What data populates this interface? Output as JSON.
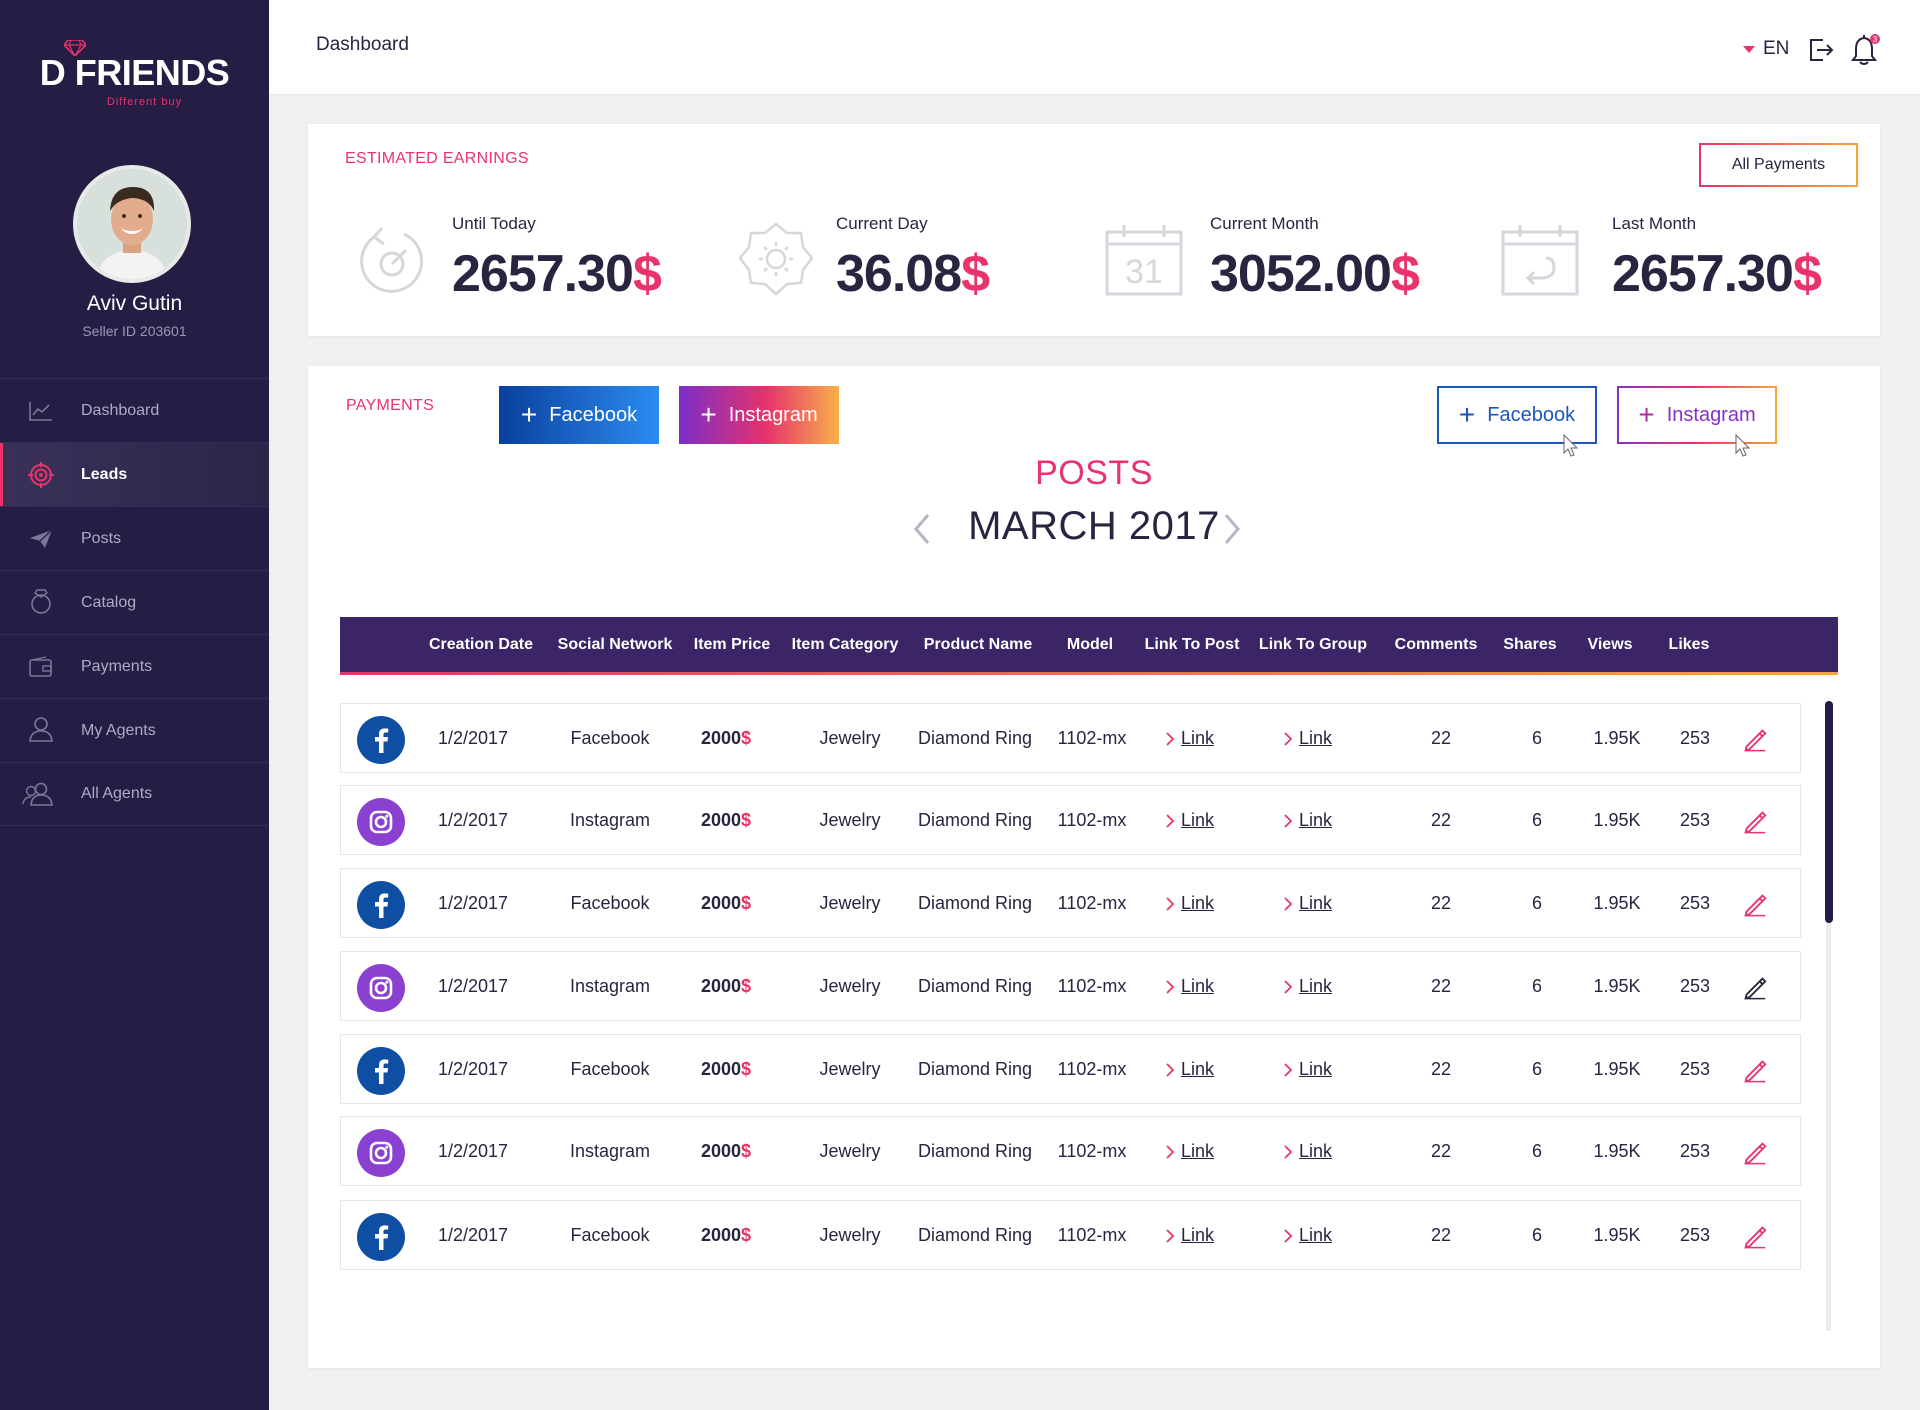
{
  "brand": {
    "name": "D FRIENDS",
    "tagline": "Different buy",
    "accent": "#e8336b",
    "sidebar_bg": "#251d44"
  },
  "user": {
    "name": "Aviv Gutin",
    "seller_id": "Seller ID 203601"
  },
  "sidebar": {
    "items": [
      {
        "label": "Dashboard",
        "icon": "chart-line-icon",
        "active": false
      },
      {
        "label": "Leads",
        "icon": "target-icon",
        "active": true
      },
      {
        "label": "Posts",
        "icon": "paper-plane-icon",
        "active": false
      },
      {
        "label": "Catalog",
        "icon": "ring-icon",
        "active": false
      },
      {
        "label": "Payments",
        "icon": "wallet-icon",
        "active": false
      },
      {
        "label": "My Agents",
        "icon": "user-icon",
        "active": false
      },
      {
        "label": "All Agents",
        "icon": "users-icon",
        "active": false
      }
    ]
  },
  "header": {
    "title": "Dashboard",
    "language": "EN",
    "notifications": "3"
  },
  "earnings": {
    "label": "ESTIMATED EARNINGS",
    "all_payments_label": "All Payments",
    "stats": [
      {
        "label": "Until Today",
        "value": "2657.30",
        "currency": "$",
        "icon": "history-icon"
      },
      {
        "label": "Current Day",
        "value": "36.08",
        "currency": "$",
        "icon": "sun-icon"
      },
      {
        "label": "Current Month",
        "value": "3052.00",
        "currency": "$",
        "icon": "calendar-31-icon",
        "calendar_day": "31"
      },
      {
        "label": "Last Month",
        "value": "2657.30",
        "currency": "$",
        "icon": "calendar-undo-icon"
      }
    ]
  },
  "payments": {
    "label": "PAYMENTS",
    "buttons": {
      "facebook": "Facebook",
      "instagram": "Instagram"
    },
    "posts_title": "POSTS",
    "month": "MARCH  2017"
  },
  "table": {
    "headers": [
      "Creation Date",
      "Social Network",
      "Item Price",
      "Item Category",
      "Product Name",
      "Model",
      "Link To Post",
      "Link To Group",
      "Comments",
      "Shares",
      "Views",
      "Likes"
    ],
    "rows": [
      {
        "network_icon": "facebook-icon",
        "date": "1/2/2017",
        "network": "Facebook",
        "price": "2000",
        "currency": "$",
        "category": "Jewelry",
        "product": "Diamond Ring",
        "model": "1102-mx",
        "link_post": "Link",
        "link_group": "Link",
        "comments": "22",
        "shares": "6",
        "views": "1.95K",
        "likes": "253"
      },
      {
        "network_icon": "instagram-icon",
        "date": "1/2/2017",
        "network": "Instagram",
        "price": "2000",
        "currency": "$",
        "category": "Jewelry",
        "product": "Diamond Ring",
        "model": "1102-mx",
        "link_post": "Link",
        "link_group": "Link",
        "comments": "22",
        "shares": "6",
        "views": "1.95K",
        "likes": "253"
      },
      {
        "network_icon": "facebook-icon",
        "date": "1/2/2017",
        "network": "Facebook",
        "price": "2000",
        "currency": "$",
        "category": "Jewelry",
        "product": "Diamond Ring",
        "model": "1102-mx",
        "link_post": "Link",
        "link_group": "Link",
        "comments": "22",
        "shares": "6",
        "views": "1.95K",
        "likes": "253"
      },
      {
        "network_icon": "instagram-icon",
        "date": "1/2/2017",
        "network": "Instagram",
        "price": "2000",
        "currency": "$",
        "category": "Jewelry",
        "product": "Diamond Ring",
        "model": "1102-mx",
        "link_post": "Link",
        "link_group": "Link",
        "comments": "22",
        "shares": "6",
        "views": "1.95K",
        "likes": "253"
      },
      {
        "network_icon": "facebook-icon",
        "date": "1/2/2017",
        "network": "Facebook",
        "price": "2000",
        "currency": "$",
        "category": "Jewelry",
        "product": "Diamond Ring",
        "model": "1102-mx",
        "link_post": "Link",
        "link_group": "Link",
        "comments": "22",
        "shares": "6",
        "views": "1.95K",
        "likes": "253"
      },
      {
        "network_icon": "instagram-icon",
        "date": "1/2/2017",
        "network": "Instagram",
        "price": "2000",
        "currency": "$",
        "category": "Jewelry",
        "product": "Diamond Ring",
        "model": "1102-mx",
        "link_post": "Link",
        "link_group": "Link",
        "comments": "22",
        "shares": "6",
        "views": "1.95K",
        "likes": "253"
      },
      {
        "network_icon": "facebook-icon",
        "date": "1/2/2017",
        "network": "Facebook",
        "price": "2000",
        "currency": "$",
        "category": "Jewelry",
        "product": "Diamond Ring",
        "model": "1102-mx",
        "link_post": "Link",
        "link_group": "Link",
        "comments": "22",
        "shares": "6",
        "views": "1.95K",
        "likes": "253"
      }
    ]
  }
}
